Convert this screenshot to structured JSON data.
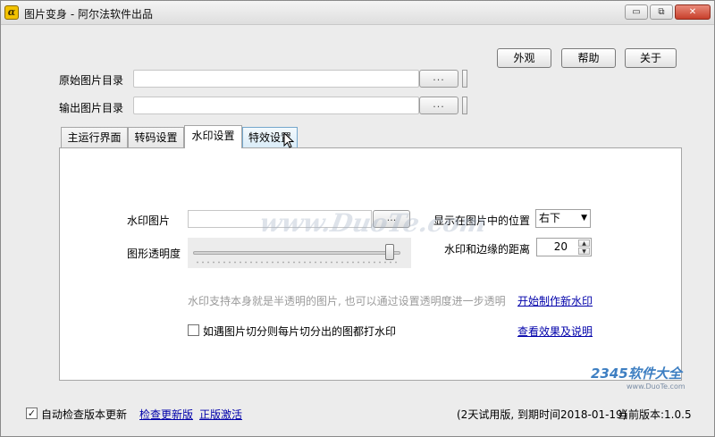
{
  "window": {
    "title": "图片变身 - 阿尔法软件出品",
    "app_icon_glyph": "α",
    "buttons": {
      "minimize": "▭",
      "restore": "⧉",
      "close": "✕"
    }
  },
  "toolbar": {
    "appearance": "外观",
    "help": "帮助",
    "about": "关于"
  },
  "paths": {
    "source_label": "原始图片目录",
    "output_label": "输出图片目录",
    "browse": "..."
  },
  "tabs": [
    "主运行界面",
    "转码设置",
    "水印设置",
    "特效设置"
  ],
  "watermark": {
    "image_label": "水印图片",
    "browse": "...",
    "position_label": "显示在图片中的位置",
    "position_value": "右下",
    "opacity_label": "图形透明度",
    "opacity_fraction": 0.97,
    "margin_label": "水印和边缘的距离",
    "margin_value": "20",
    "hint": "水印支持本身就是半透明的图片, 也可以通过设置透明度进一步透明",
    "create_link": "开始制作新水印",
    "tile_checkbox_label": "如遇图片切分则每片切分出的图都打水印",
    "tile_checked": false,
    "view_link": "查看效果及说明"
  },
  "footer": {
    "auto_update_label": "自动检查版本更新",
    "auto_update_checked": true,
    "check_update_link": "检查更新版",
    "activate_link": "正版激活",
    "trial_status": "(2天试用版, 到期时间2018-01-19)",
    "version": "当前版本:1.0.5"
  },
  "overlays": {
    "duote": "www.DuoTe.com",
    "brand_2345": "2345软件大全",
    "brand_2345_sub": "www.DuoTe.com"
  }
}
